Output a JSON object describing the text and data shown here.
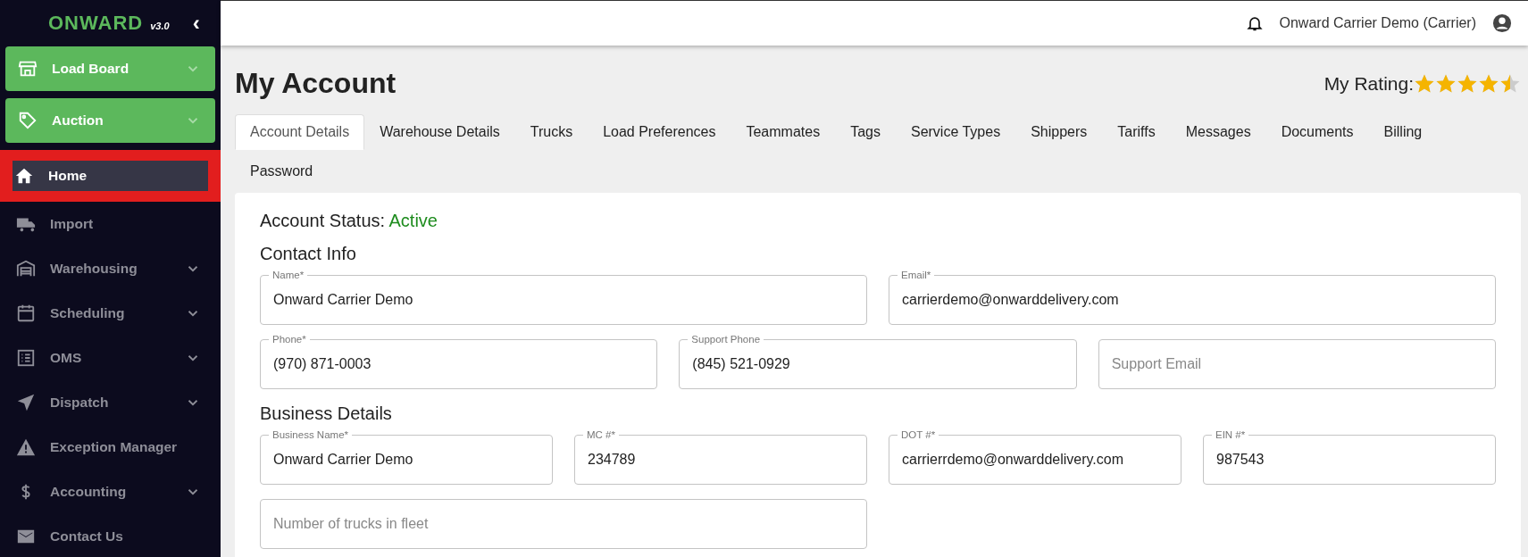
{
  "sidebar": {
    "logo": "ONWARD",
    "version": "v3.0",
    "collapse": "‹",
    "items": [
      {
        "kind": "group",
        "label": "Load Board",
        "expandable": true,
        "selected": false
      },
      {
        "kind": "group",
        "label": "Auction",
        "expandable": true,
        "selected": false
      },
      {
        "kind": "link",
        "label": "Home",
        "expandable": false,
        "selected": true,
        "highlighted": true
      },
      {
        "kind": "link",
        "label": "Import",
        "expandable": false,
        "selected": false,
        "highlighted": false
      },
      {
        "kind": "link",
        "label": "Warehousing",
        "expandable": true,
        "selected": false,
        "highlighted": false
      },
      {
        "kind": "link",
        "label": "Scheduling",
        "expandable": true,
        "selected": false,
        "highlighted": false
      },
      {
        "kind": "link",
        "label": "OMS",
        "expandable": true,
        "selected": false,
        "highlighted": false
      },
      {
        "kind": "link",
        "label": "Dispatch",
        "expandable": true,
        "selected": false,
        "highlighted": false
      },
      {
        "kind": "link",
        "label": "Exception Manager",
        "expandable": false,
        "selected": false,
        "highlighted": false
      },
      {
        "kind": "link",
        "label": "Accounting",
        "expandable": true,
        "selected": false,
        "highlighted": false
      },
      {
        "kind": "link",
        "label": "Contact Us",
        "expandable": false,
        "selected": false,
        "highlighted": false
      }
    ]
  },
  "header": {
    "user": "Onward Carrier Demo (Carrier)"
  },
  "page": {
    "title": "My Account",
    "rating_label": "My Rating:",
    "stars": 4.5
  },
  "tabs": [
    {
      "label": "Account Details",
      "selected": true
    },
    {
      "label": "Warehouse Details",
      "selected": false
    },
    {
      "label": "Trucks",
      "selected": false
    },
    {
      "label": "Load Preferences",
      "selected": false
    },
    {
      "label": "Teammates",
      "selected": false
    },
    {
      "label": "Tags",
      "selected": false
    },
    {
      "label": "Service Types",
      "selected": false
    },
    {
      "label": "Shippers",
      "selected": false
    },
    {
      "label": "Tariffs",
      "selected": false
    },
    {
      "label": "Messages",
      "selected": false
    },
    {
      "label": "Documents",
      "selected": false
    },
    {
      "label": "Billing",
      "selected": false
    },
    {
      "label": "Password",
      "selected": false
    }
  ],
  "account": {
    "status_label": "Account Status:",
    "status": "Active",
    "sections": [
      {
        "title": "Contact Info",
        "rows": [
          [
            {
              "label": "Name*",
              "value": "Onward Carrier Demo"
            },
            {
              "label": "Email*",
              "value": "carrierdemo@onwarddelivery.com"
            }
          ],
          [
            {
              "label": "Phone*",
              "value": "(970) 871-0003"
            },
            {
              "label": "Support Phone",
              "value": "(845) 521-0929"
            },
            {
              "placeholder": "Support Email"
            }
          ]
        ]
      },
      {
        "title": "Business Details",
        "rows": [
          [
            {
              "label": "Business Name*",
              "value": "Onward Carrier Demo"
            },
            {
              "label": "MC #*",
              "value": "234789"
            },
            {
              "label": "DOT #*",
              "value": "carrierrdemo@onwarddelivery.com"
            },
            {
              "label": "EIN #*",
              "value": "987543"
            }
          ],
          [
            {
              "placeholder": "Number of trucks in fleet"
            }
          ]
        ]
      }
    ]
  }
}
